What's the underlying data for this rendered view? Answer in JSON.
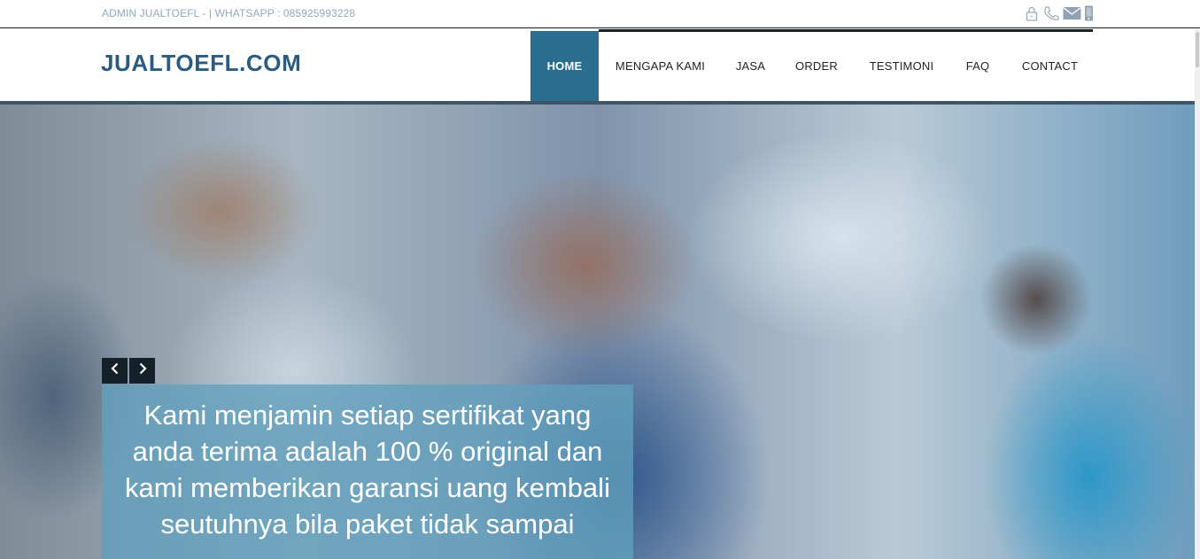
{
  "topbar": {
    "text": "ADMIN JUALTOEFL - | WHATSAPP : 085925993228",
    "icons": [
      "lock-icon",
      "phone-icon",
      "mail-icon",
      "mobile-icon"
    ]
  },
  "brand": {
    "logo": "JUALTOEFL.COM"
  },
  "nav": {
    "items": [
      {
        "label": "HOME",
        "active": true
      },
      {
        "label": "MENGAPA KAMI"
      },
      {
        "label": "JASA"
      },
      {
        "label": "ORDER"
      },
      {
        "label": "TESTIMONI"
      },
      {
        "label": "FAQ"
      },
      {
        "label": "CONTACT"
      }
    ]
  },
  "hero": {
    "prev_icon": "chevron-left-icon",
    "next_icon": "chevron-right-icon",
    "caption": "Kami menjamin setiap sertifikat yang anda terima adalah 100 % original dan kami memberikan garansi uang kembali seutuhnya bila paket tidak sampai"
  },
  "colors": {
    "brand": "#2a5c80",
    "nav_active_bg": "#2a6d91",
    "topbar_text": "#8fa9bd",
    "dark": "#14212b"
  }
}
